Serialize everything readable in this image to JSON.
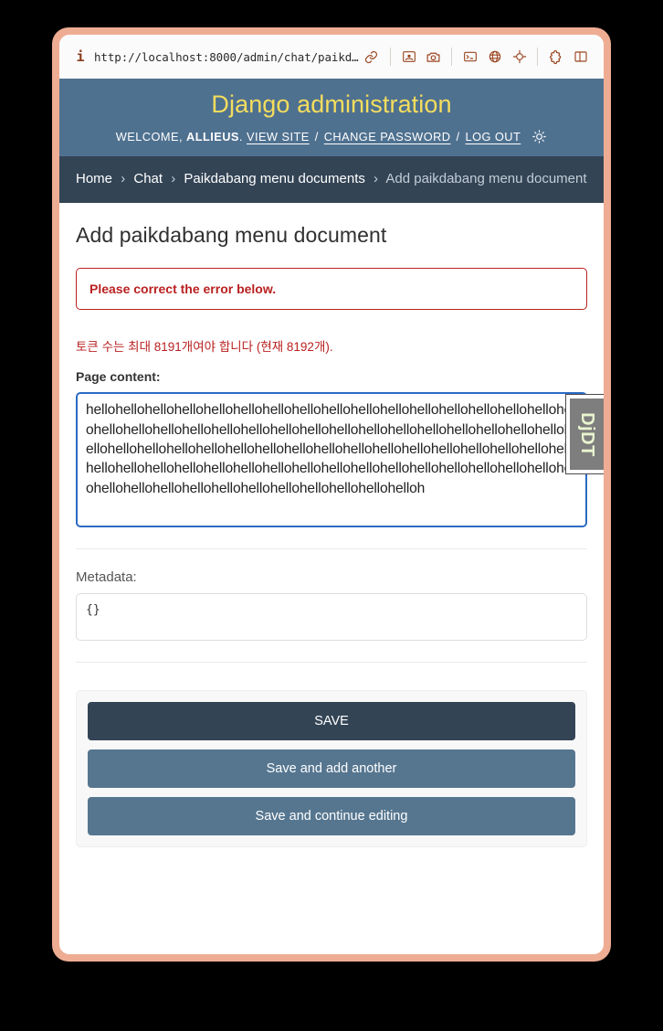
{
  "browser": {
    "info_icon": "i",
    "url": "http://localhost:8000/admin/chat/paikd…",
    "link_icon": "link-icon",
    "toolbar_icons": [
      "reader-mode-icon",
      "camera-icon",
      "terminal-icon",
      "globe-icon",
      "crosshair-icon",
      "puzzle-icon",
      "sidebar-icon"
    ]
  },
  "header": {
    "site_title": "Django administration",
    "welcome_prefix": "WELCOME,",
    "username": "ALLIEUS",
    "username_suffix": ".",
    "view_site": "VIEW SITE",
    "change_password": "CHANGE PASSWORD",
    "log_out": "LOG OUT",
    "separator": "/",
    "theme_toggle_icon": "sun-icon"
  },
  "breadcrumbs": {
    "items": [
      {
        "label": "Home",
        "current": false
      },
      {
        "label": "Chat",
        "current": false
      },
      {
        "label": "Paikdabang menu documents",
        "current": false
      },
      {
        "label": "Add paikdabang menu document",
        "current": true
      }
    ],
    "separator": "›"
  },
  "main": {
    "page_title": "Add paikdabang menu document",
    "errornote": "Please correct the error below.",
    "fields": [
      {
        "name": "page-content",
        "label": "Page content:",
        "error": "토큰 수는 최대 8191개여야 합니다 (현재 8192개).",
        "value": "hellohellohellohellohellohellohellohellohellohellohellohellohellohellohellohellohellohellohellohellohellohellohellohellohellohellohellohellohellohellohellohellohellohellohellohellohellohellohellohellohellohellohellohellohellohellohellohellohellohellohellohellohellohellohellohellohellohellohellohellohellohellohellohellohellohellohellohellohellohellohellohellohellohellohellohellohellohelloh"
      },
      {
        "name": "metadata",
        "label": "Metadata:",
        "value": "{}"
      }
    ]
  },
  "submit_row": {
    "save": "SAVE",
    "save_and_add_another": "Save and add another",
    "save_and_continue": "Save and continue editing"
  },
  "debug_toolbar": {
    "label": "DjDT"
  },
  "colors": {
    "frame": "#eead93",
    "header_bg": "#4f7190",
    "header_title": "#f5dd5d",
    "breadcrumb_bg": "#334455",
    "error": "#ba2121",
    "primary_button": "#334455",
    "secondary_button": "#567690",
    "focus_border": "#2b6bc4"
  }
}
